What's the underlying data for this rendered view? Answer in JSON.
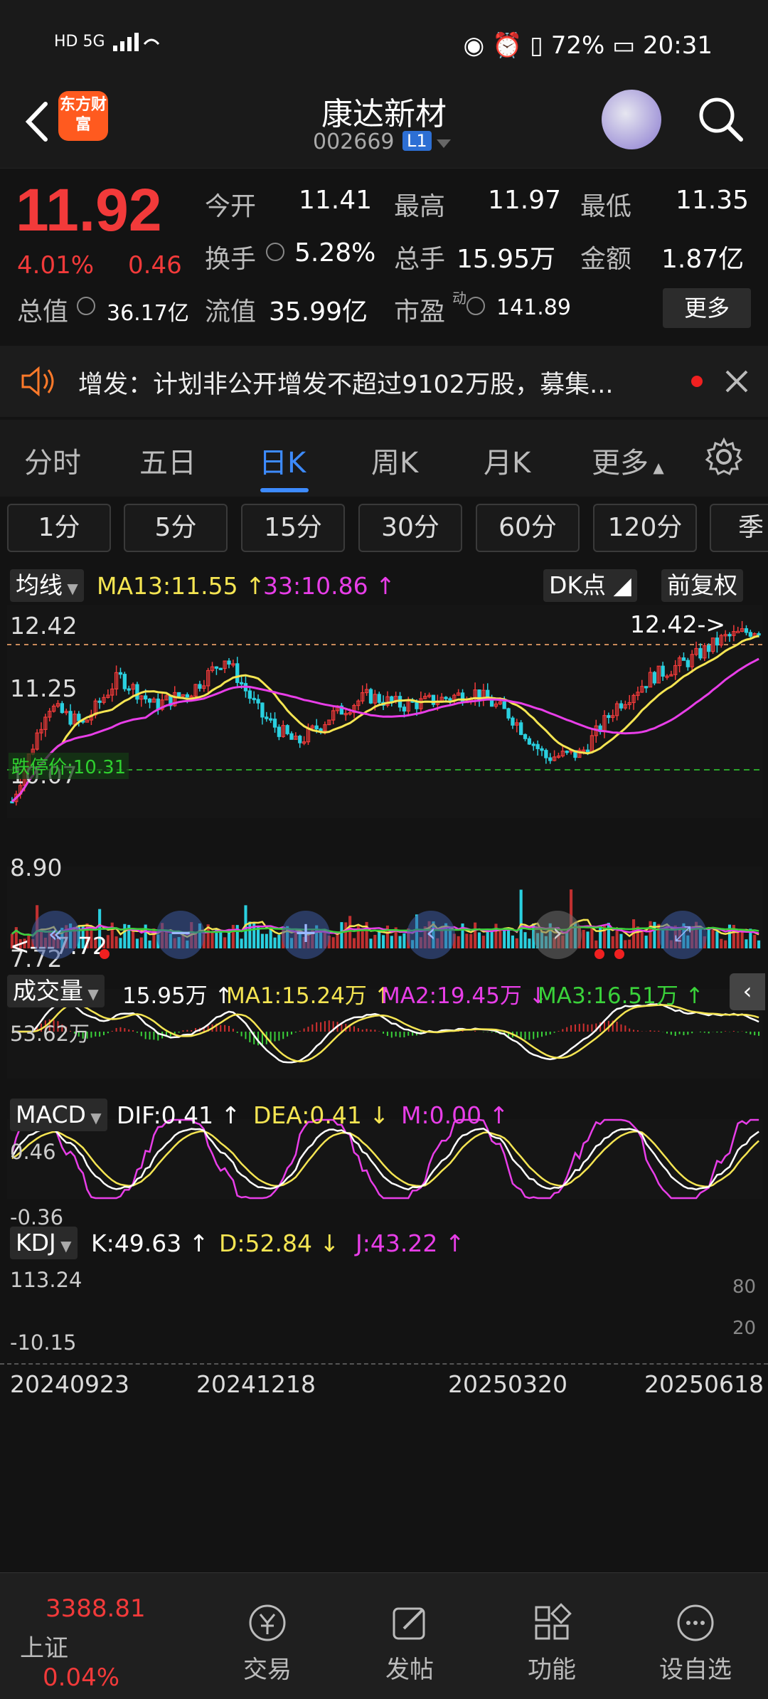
{
  "status": {
    "left_icons": "HD 5G",
    "battery": "72%",
    "time": "20:31"
  },
  "header": {
    "logo_text": "东方财富",
    "name": "康达新材",
    "code": "002669",
    "level": "L1"
  },
  "quote": {
    "price": "11.92",
    "pct": "4.01%",
    "change": "0.46",
    "open_label": "今开",
    "open": "11.41",
    "high_label": "最高",
    "high": "11.97",
    "low_label": "最低",
    "low": "11.35",
    "turnover_label": "换手",
    "turnover": "5.28%",
    "volume_label": "总手",
    "volume": "15.95万",
    "amount_label": "金额",
    "amount": "1.87亿",
    "mktcap_label": "总值",
    "mktcap": "36.17亿",
    "float_label": "流值",
    "float": "35.99亿",
    "pe_label": "市盈",
    "pe_sup": "动",
    "pe": "141.89",
    "more": "更多"
  },
  "notice": {
    "text": "增发：计划非公开增发不超过9102万股，募集..."
  },
  "tabs": [
    "分时",
    "五日",
    "日K",
    "周K",
    "月K",
    "更多"
  ],
  "active_tab": "日K",
  "intervals": [
    "1分",
    "5分",
    "15分",
    "30分",
    "60分",
    "120分",
    "季"
  ],
  "main_chart": {
    "ma_label": "均线",
    "ma13": "MA13:11.55",
    "ma33": "33:10.86",
    "dk_label": "DK点",
    "fq_label": "前复权",
    "y_ticks": [
      "12.42",
      "11.25",
      "10.07",
      "8.90",
      "7.72"
    ],
    "limit_label": "跌停价:10.31",
    "high_marker": "12.42->",
    "low_marker": "<---7.72"
  },
  "volume_chart": {
    "label": "成交量",
    "vol": "15.95万",
    "ma1": "MA1:15.24万",
    "ma2": "MA2:19.45万",
    "ma3": "MA3:16.51万",
    "y_tick": "53.62万"
  },
  "macd_chart": {
    "label": "MACD",
    "dif": "DIF:0.41",
    "dea": "DEA:0.41",
    "m": "M:0.00",
    "y_top": "0.46",
    "y_bottom": "-0.36"
  },
  "kdj_chart": {
    "label": "KDJ",
    "k": "K:49.63",
    "d": "D:52.84",
    "j": "J:43.22",
    "y_top": "113.24",
    "y_bottom": "-10.15",
    "r80": "80",
    "r20": "20"
  },
  "x_dates": [
    "20240923",
    "20241218",
    "20250320",
    "20250618"
  ],
  "bottom_nav": {
    "index_value": "3388.81",
    "index_name": "上证",
    "index_pct": "0.04%",
    "items": [
      "交易",
      "发帖",
      "功能",
      "设自选"
    ]
  },
  "colors": {
    "up": "#f23a3a",
    "down": "#27c93a",
    "accent": "#3d8bff",
    "ma_yellow": "#f5e552",
    "ma_magenta": "#e83ee8"
  }
}
